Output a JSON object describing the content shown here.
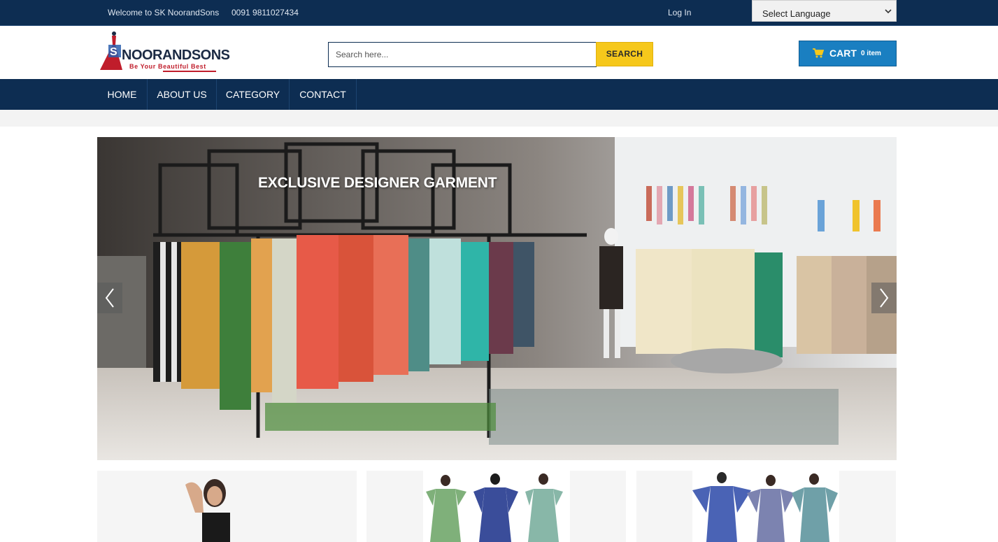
{
  "topbar": {
    "welcome": "Welcome to SK NoorandSons",
    "phone": "0091 9811027434",
    "login": "Log In",
    "language_selected": "Select Language"
  },
  "header": {
    "logo_text": "SKNOORANDSONS",
    "logo_brand": "NOORANDSONS",
    "logo_tagline": "Be Your Beautiful Best",
    "search_placeholder": "Search here...",
    "search_button": "SEARCH",
    "cart_label": "CART",
    "cart_count": "0 item"
  },
  "nav": {
    "items": [
      {
        "label": "HOME"
      },
      {
        "label": "ABOUT US"
      },
      {
        "label": "CATEGORY"
      },
      {
        "label": "CONTACT"
      }
    ]
  },
  "slider": {
    "caption": "EXCLUSIVE DESIGNER GARMENT",
    "prev_icon": "chevron-left-icon",
    "next_icon": "chevron-right-icon"
  },
  "products": {
    "tiles": [
      {
        "image": "model-black-top-photo"
      },
      {
        "image": "three-dresses-photo"
      },
      {
        "image": "three-kaftans-photo"
      }
    ]
  },
  "colors": {
    "navy": "#0d2d52",
    "search_yellow": "#f6c81b",
    "cart_blue": "#1a7fc1",
    "logo_red": "#c01d2b"
  }
}
